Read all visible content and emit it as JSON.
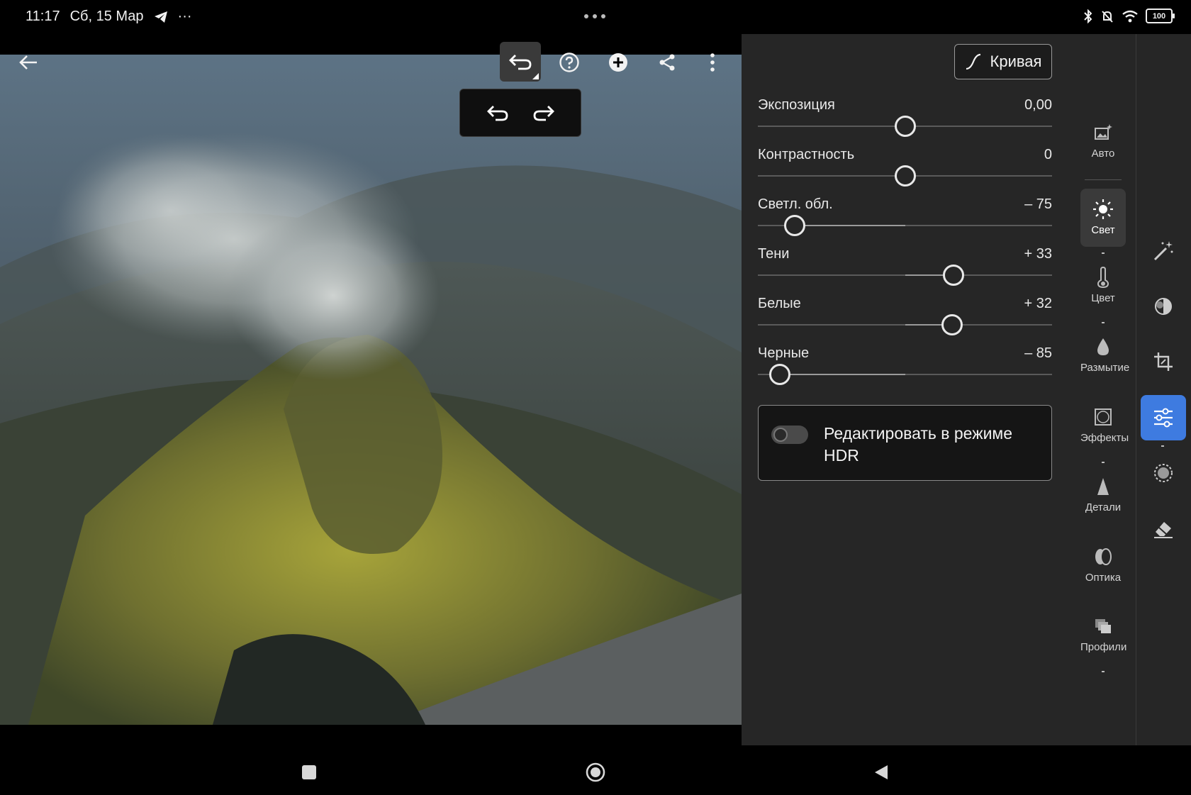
{
  "status_bar": {
    "time": "11:17",
    "date": "Сб, 15 Мар",
    "overflow": "···",
    "battery": "100",
    "icons": [
      "telegram-icon",
      "bluetooth-icon",
      "mute-icon",
      "wifi-icon",
      "battery-icon"
    ]
  },
  "toolbar": {
    "icons": [
      "back-arrow-icon",
      "undo-icon",
      "help-icon",
      "add-icon",
      "share-icon",
      "more-vert-icon"
    ],
    "undo_popup": [
      "undo-icon",
      "redo-icon"
    ]
  },
  "panel": {
    "curve_label": "Кривая",
    "sliders": [
      {
        "label": "Экспозиция",
        "value": "0,00",
        "amount": 0
      },
      {
        "label": "Контрастность",
        "value": "0",
        "amount": 0
      },
      {
        "label": "Светл. обл.",
        "value": "– 75",
        "amount": -75
      },
      {
        "label": "Тени",
        "value": "+ 33",
        "amount": 33
      },
      {
        "label": "Белые",
        "value": "+ 32",
        "amount": 32
      },
      {
        "label": "Черные",
        "value": "– 85",
        "amount": -85
      }
    ],
    "hdr_label": "Редактировать в режиме HDR",
    "hdr_enabled": false
  },
  "categories": [
    {
      "label": "Авто",
      "icon": "auto-icon"
    },
    {
      "label": "Свет",
      "icon": "light-icon",
      "active": true
    },
    {
      "label": "Цвет",
      "icon": "thermometer-icon"
    },
    {
      "label": "Размытие",
      "icon": "drop-icon"
    },
    {
      "label": "Эффекты",
      "icon": "effects-icon"
    },
    {
      "label": "Детали",
      "icon": "details-icon"
    },
    {
      "label": "Оптика",
      "icon": "lens-icon"
    },
    {
      "label": "Профили",
      "icon": "profiles-icon"
    }
  ],
  "tools": [
    "magic-wand-icon",
    "healing-icon",
    "crop-icon",
    "adjust-sliders-icon",
    "masking-icon",
    "eraser-icon"
  ],
  "active_tool": "adjust-sliders-icon",
  "colors": {
    "accent": "#3e7be0",
    "panel_bg": "#262626"
  }
}
